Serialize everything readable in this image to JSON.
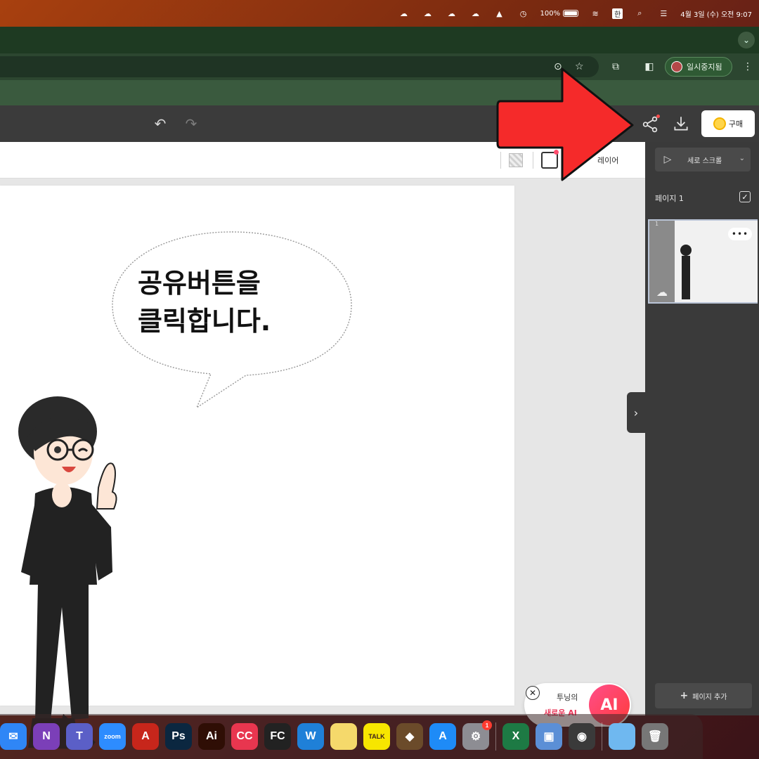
{
  "menubar": {
    "battery_label": "100%",
    "input_label": "한",
    "datetime": "4월 3일 (수) 오전 9:07"
  },
  "browser": {
    "profile_status": "일시중지됨"
  },
  "app": {
    "buy_label": "구매",
    "layer_label": "레이어"
  },
  "canvas": {
    "bubble_line1": "공유버튼을",
    "bubble_line2": "클릭합니다."
  },
  "ai_promo": {
    "line1": "투닝의",
    "line2": "새로운 AI",
    "badge": "AI"
  },
  "right_panel": {
    "scroll_mode": "세로 스크롤",
    "page_label": "페이지 1",
    "thumb_number": "1",
    "add_page_label": "페이지 추가"
  },
  "dock": {
    "apps": [
      {
        "name": "mail",
        "label": "✉",
        "color": "#2f86f6"
      },
      {
        "name": "onenote",
        "label": "N",
        "color": "#7b3fb8"
      },
      {
        "name": "teams",
        "label": "T",
        "color": "#5b5fc7"
      },
      {
        "name": "zoom",
        "label": "zoom",
        "color": "#2d8cff"
      },
      {
        "name": "acrobat",
        "label": "A",
        "color": "#c7261b"
      },
      {
        "name": "photoshop",
        "label": "Ps",
        "color": "#0b2740"
      },
      {
        "name": "illustrator",
        "label": "Ai",
        "color": "#2f0e05"
      },
      {
        "name": "creative-cloud",
        "label": "CC",
        "color": "#e8364f"
      },
      {
        "name": "final-cut",
        "label": "FC",
        "color": "#222222"
      },
      {
        "name": "word-app",
        "label": "W",
        "color": "#1f80d8"
      },
      {
        "name": "notes",
        "label": "",
        "color": "#f5d96b"
      },
      {
        "name": "kakaotalk",
        "label": "TALK",
        "color": "#f7e600"
      },
      {
        "name": "app-misc",
        "label": "◆",
        "color": "#6b4b2a"
      },
      {
        "name": "app-store",
        "label": "A",
        "color": "#1e8bf7"
      },
      {
        "name": "settings",
        "label": "⚙",
        "color": "#8d8d93",
        "badge": "1"
      },
      {
        "name": "excel",
        "label": "X",
        "color": "#1d7a44"
      },
      {
        "name": "preview",
        "label": "▣",
        "color": "#5b8fd6"
      },
      {
        "name": "screenshot",
        "label": "◉",
        "color": "#3a3a3a"
      },
      {
        "name": "downloads-folder",
        "label": "",
        "color": "#6fb8f0"
      },
      {
        "name": "trash",
        "label": "🗑",
        "color": "#777777"
      }
    ]
  },
  "colors": {
    "arrow": "#f52a2a",
    "accent_ai": "#ff3b6b"
  }
}
